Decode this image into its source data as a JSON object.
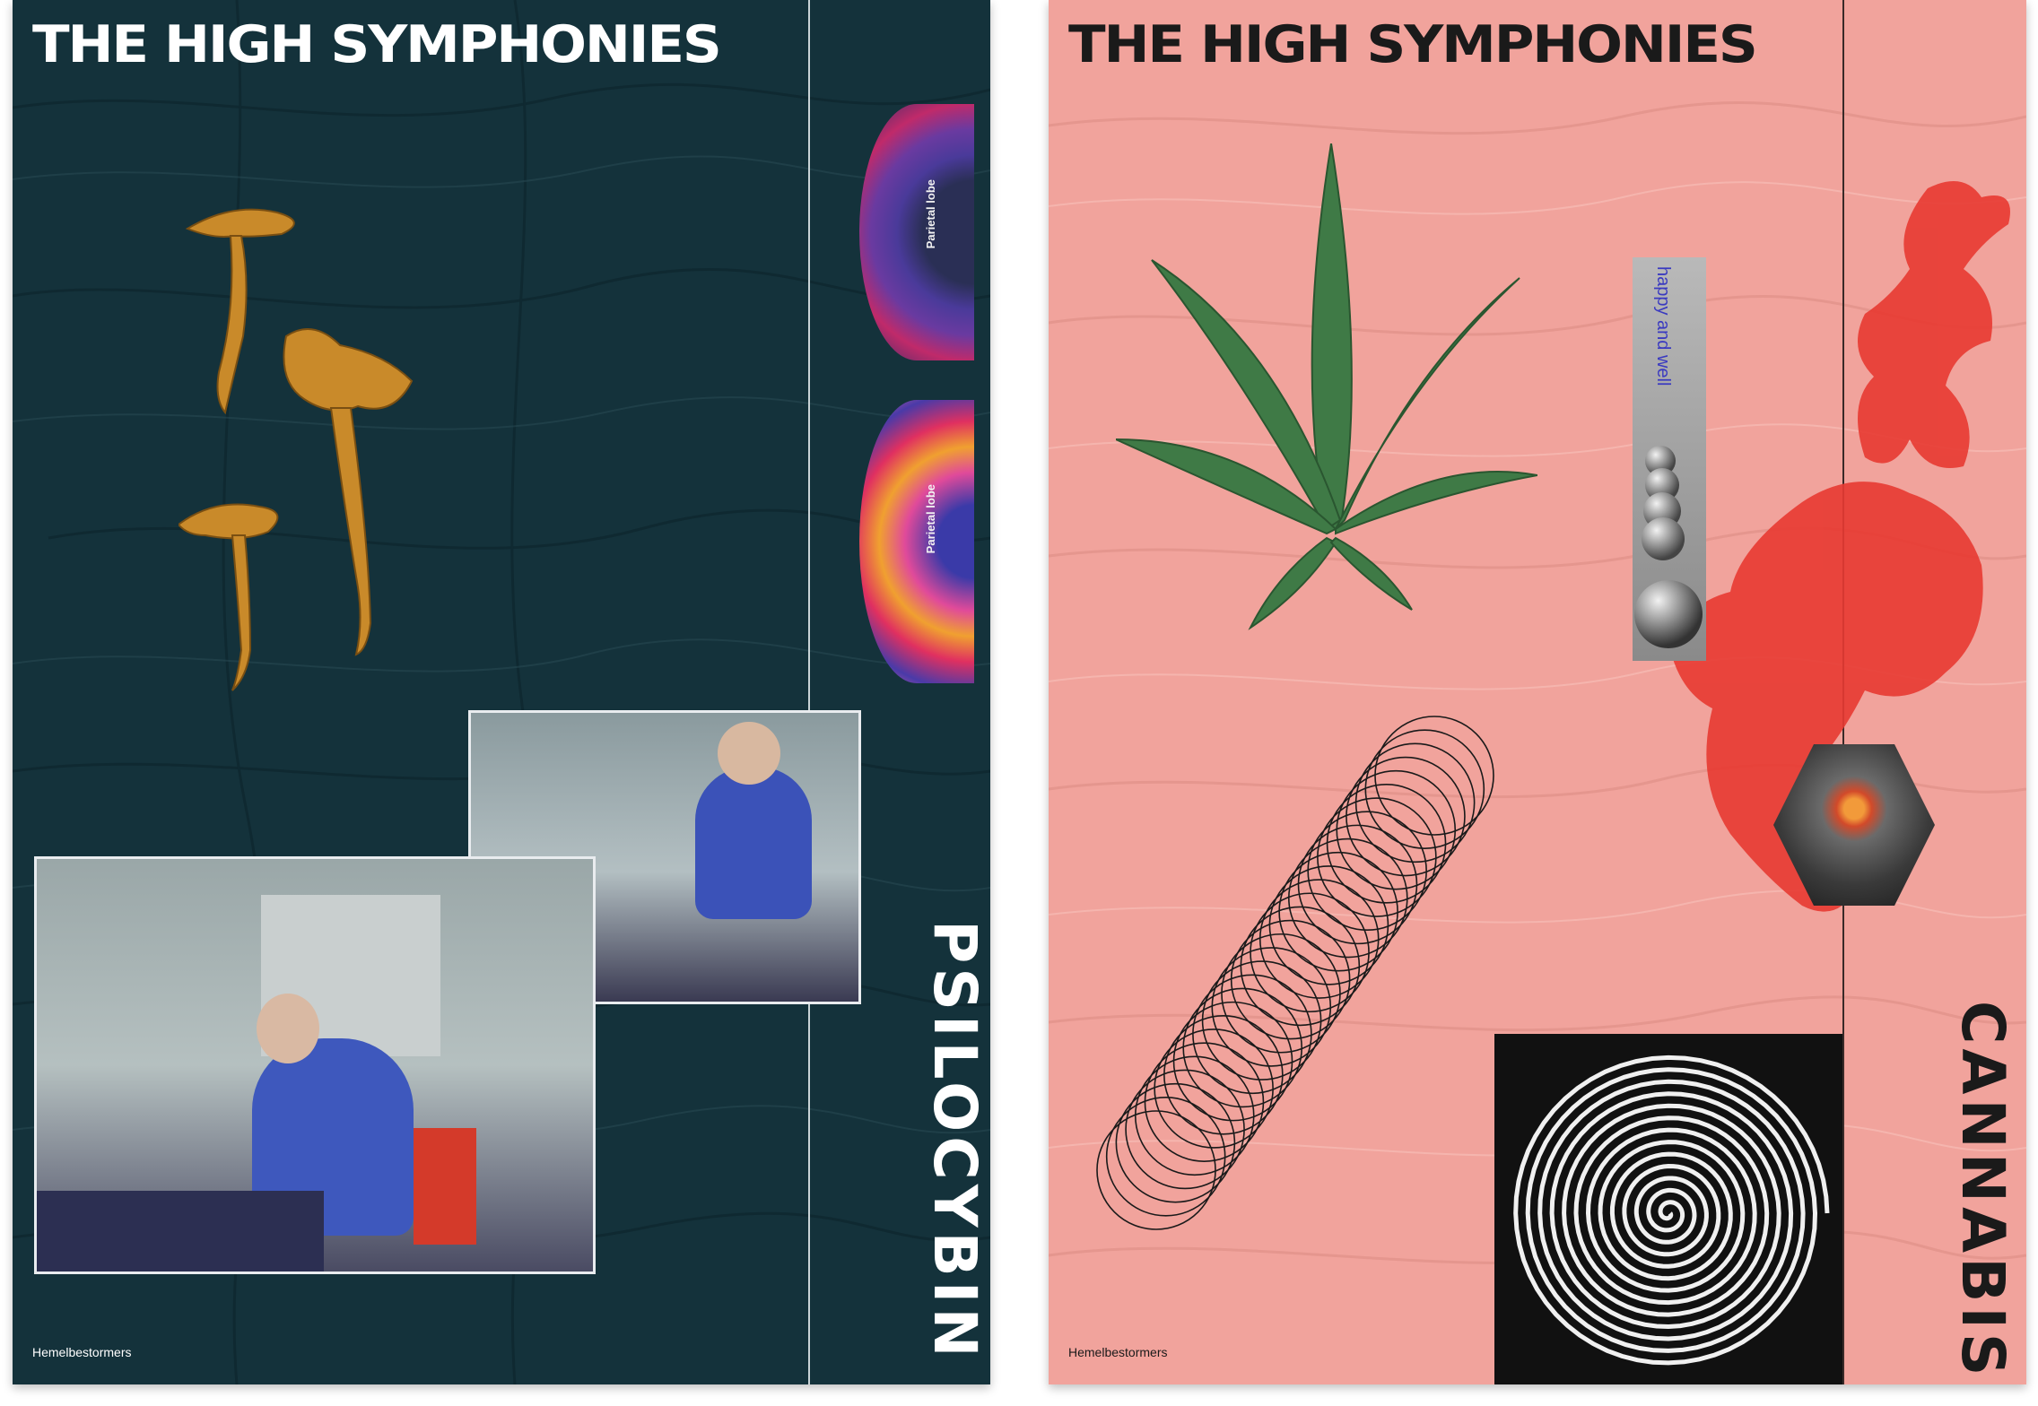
{
  "colors": {
    "left_bg": "#14323b",
    "left_text": "#ffffff",
    "right_bg": "#f1a39c",
    "right_text": "#1a1a1a",
    "splash": "#e83a32",
    "mushroom": "#c98a2a",
    "leaf": "#3f7a46"
  },
  "posters": {
    "left": {
      "title": "THE HIGH SYMPHONIES",
      "vertical_word": "PSILOCYBIN",
      "credit": "Hemelbestormers",
      "brain_labels": [
        "Parietal lobe",
        "Parietal lobe"
      ]
    },
    "right": {
      "title": "THE HIGH SYMPHONIES",
      "vertical_word": "CANNABIS",
      "credit": "Hemelbestormers",
      "strip_text": "happy and well"
    }
  }
}
